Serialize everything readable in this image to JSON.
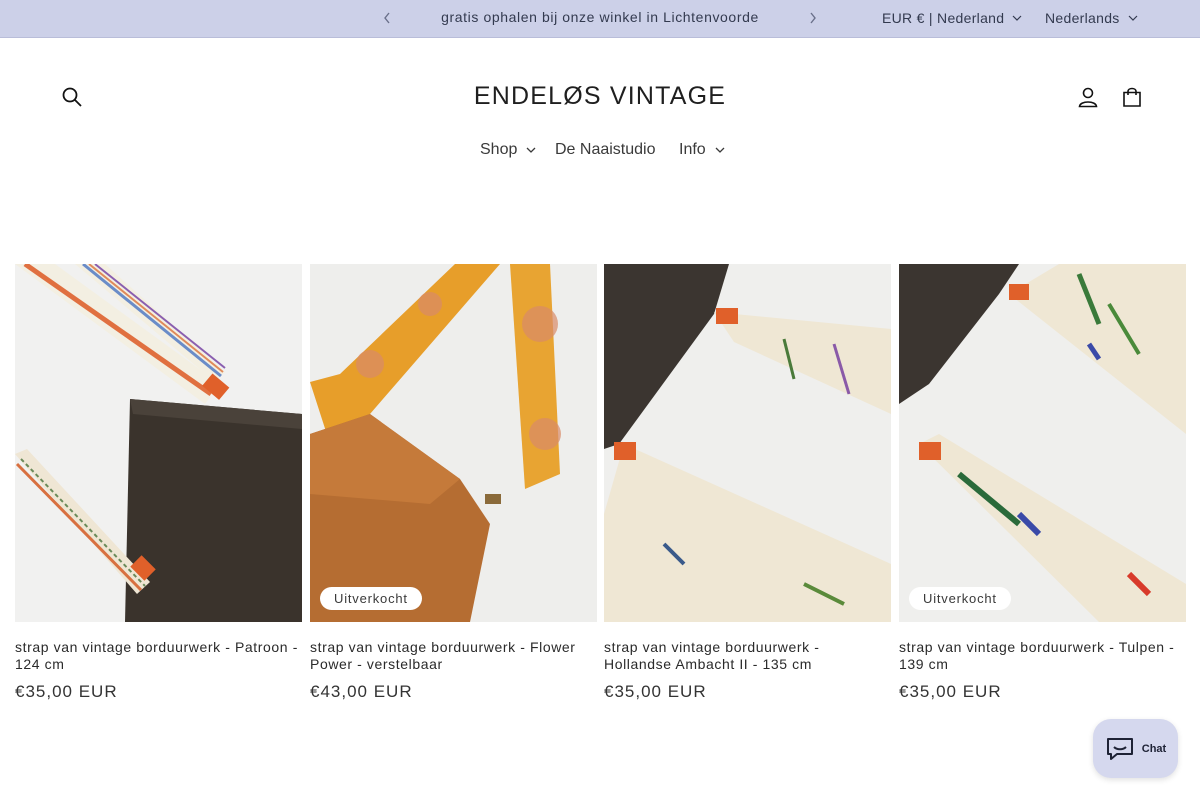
{
  "announcement": {
    "text": "gratis ophalen bij onze winkel in Lichtenvoorde",
    "prev_icon": "chevron-left-icon",
    "next_icon": "chevron-right-icon"
  },
  "localization": {
    "currency": "EUR € | Nederland",
    "language": "Nederlands"
  },
  "header": {
    "logo": "ENDELØS VINTAGE",
    "search_icon": "search-icon",
    "account_icon": "account-icon",
    "cart_icon": "cart-icon"
  },
  "nav": {
    "items": [
      {
        "label": "Shop",
        "has_dropdown": true
      },
      {
        "label": "De Naaistudio",
        "has_dropdown": false
      },
      {
        "label": "Info",
        "has_dropdown": true
      }
    ]
  },
  "products": [
    {
      "title": "strap van vintage borduurwerk - Patroon - 124 cm",
      "price": "€35,00 EUR",
      "badge": ""
    },
    {
      "title": "strap van vintage borduurwerk - Flower Power - verstelbaar",
      "price": "€43,00 EUR",
      "badge": "Uitverkocht"
    },
    {
      "title": "strap van vintage borduurwerk - Hollandse Ambacht II - 135 cm",
      "price": "€35,00 EUR",
      "badge": ""
    },
    {
      "title": "strap van vintage borduurwerk - Tulpen - 139 cm",
      "price": "€35,00 EUR",
      "badge": "Uitverkocht"
    }
  ],
  "chat": {
    "label": "Chat",
    "icon": "chat-bubble-icon"
  },
  "colors": {
    "announcement_bg": "#ccd0e8",
    "chat_bg": "#d5d8ee",
    "text": "#121212"
  }
}
